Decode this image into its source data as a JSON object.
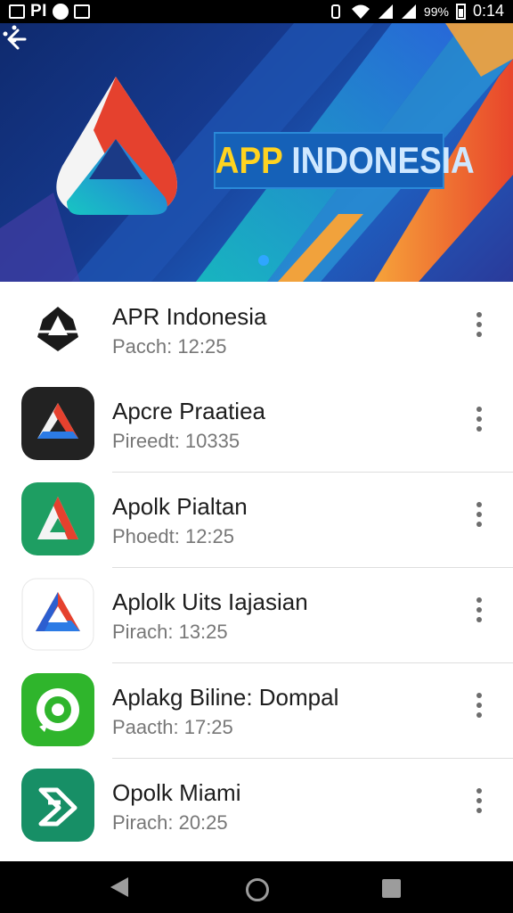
{
  "status_bar": {
    "left_text": "PI",
    "time": "0:14",
    "battery": "99%"
  },
  "banner": {
    "title_highlight": "APP",
    "title_rest": "INDONESIA",
    "brand_colors": [
      "#e8362b",
      "#2c7be5",
      "#ffd320"
    ]
  },
  "apps": [
    {
      "name": "APR Indonesia",
      "meta": "Pacch:  12:25",
      "icon": "apr-logo-icon"
    },
    {
      "name": "Apcre Praatiea",
      "meta": "Pireedt:  10335",
      "icon": "black-triangle-app-icon"
    },
    {
      "name": "Apolk Pialtan",
      "meta": "Phoedt:  12:25",
      "icon": "green-triangle-app-icon"
    },
    {
      "name": "Aplolk Uits Iajasian",
      "meta": "Pirach:  13:25",
      "icon": "white-triangle-app-icon"
    },
    {
      "name": "Aplakg Biline: Dompal",
      "meta": "Paacth:  17:25",
      "icon": "green-eye-app-icon"
    },
    {
      "name": "Opolk Miami",
      "meta": "Pirach:  20:25",
      "icon": "teal-arrow-app-icon"
    }
  ],
  "icons": {
    "back": "back-arrow-icon",
    "share": "share-icon",
    "overflow": "more-vert-icon"
  }
}
